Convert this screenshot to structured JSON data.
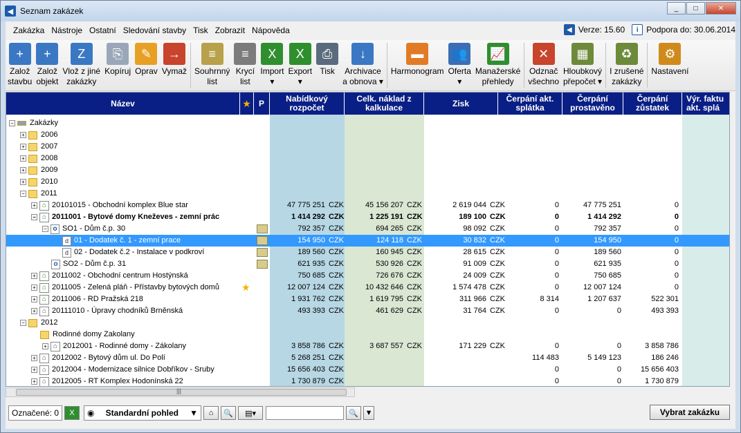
{
  "window": {
    "title": "Seznam zakázek",
    "min": "_",
    "max": "□",
    "close": "✕"
  },
  "menu": {
    "items": [
      "Zakázka",
      "Nástroje",
      "Ostatní",
      "Sledování stavby",
      "Tisk",
      "Zobrazit",
      "Nápověda"
    ]
  },
  "version": {
    "label": "Verze: 15.60",
    "support": "Podpora do: 30.06.2014"
  },
  "toolbar": {
    "buttons": [
      {
        "l1": "Založ",
        "l2": "stavbu",
        "icon": "new-project-icon"
      },
      {
        "l1": "Založ",
        "l2": "objekt",
        "icon": "new-object-icon"
      },
      {
        "l1": "Vlož z jiné",
        "l2": "zakázky",
        "icon": "insert-icon"
      },
      {
        "l1": "Kopíruj",
        "l2": "",
        "icon": "copy-icon"
      },
      {
        "l1": "Oprav",
        "l2": "",
        "icon": "edit-icon"
      },
      {
        "l1": "Vymaž",
        "l2": "",
        "icon": "delete-icon"
      },
      {
        "l1": "Souhrnný",
        "l2": "list",
        "icon": "summary-icon"
      },
      {
        "l1": "Krycí",
        "l2": "list",
        "icon": "cover-sheet-icon"
      },
      {
        "l1": "Import",
        "l2": "▾",
        "icon": "import-icon"
      },
      {
        "l1": "Export",
        "l2": "▾",
        "icon": "export-icon"
      },
      {
        "l1": "Tisk",
        "l2": "",
        "icon": "print-icon"
      },
      {
        "l1": "Archivace",
        "l2": "a obnova ▾",
        "icon": "archive-icon"
      },
      {
        "l1": "Harmonogram",
        "l2": "",
        "icon": "schedule-icon"
      },
      {
        "l1": "Oferta",
        "l2": "▾",
        "icon": "offer-icon"
      },
      {
        "l1": "Manažerské",
        "l2": "přehledy",
        "icon": "chart-icon"
      },
      {
        "l1": "Odznač",
        "l2": "všechno",
        "icon": "uncheck-icon"
      },
      {
        "l1": "Hloubkový",
        "l2": "přepočet ▾",
        "icon": "calculator-icon"
      },
      {
        "l1": "I zrušené",
        "l2": "zakázky",
        "icon": "recycle-icon"
      },
      {
        "l1": "Nastavení",
        "l2": "",
        "icon": "settings-icon"
      }
    ]
  },
  "grid": {
    "headers": {
      "name": "Název",
      "p": "P",
      "offer": [
        "Nabídkový",
        "rozpočet"
      ],
      "cost": [
        "Celk. náklad z",
        "kalkulace"
      ],
      "profit": "Zisk",
      "draw_inst": [
        "Čerpání akt.",
        "splátka"
      ],
      "draw_done": [
        "Čerpání",
        "prostavěno"
      ],
      "draw_rest": [
        "Čerpání",
        "zůstatek"
      ],
      "invoice": [
        "Výr. faktu",
        "akt. splá"
      ]
    },
    "rows": [
      {
        "label": "Zakázky",
        "indent": 0,
        "type": "root",
        "exp": "−"
      },
      {
        "label": "2006",
        "indent": 1,
        "type": "folder",
        "exp": "+"
      },
      {
        "label": "2007",
        "indent": 1,
        "type": "folder",
        "exp": "+"
      },
      {
        "label": "2008",
        "indent": 1,
        "type": "folder",
        "exp": "+"
      },
      {
        "label": "2009",
        "indent": 1,
        "type": "folder",
        "exp": "+"
      },
      {
        "label": "2010",
        "indent": 1,
        "type": "folder",
        "exp": "+"
      },
      {
        "label": "2011",
        "indent": 1,
        "type": "folder",
        "exp": "−"
      },
      {
        "label": "20101015 - Obchodní komplex Blue star",
        "indent": 2,
        "type": "house",
        "exp": "+",
        "offer": "47 775 251",
        "cost": "45 156 207",
        "profit": "2 619 044",
        "inst": "0",
        "done": "47 775 251",
        "rest": "0"
      },
      {
        "label": "2011001 - Bytové domy Kneževes - zemní prác",
        "indent": 2,
        "type": "house",
        "exp": "−",
        "bold": true,
        "offer": "1 414 292",
        "cost": "1 225 191",
        "profit": "189 100",
        "inst": "0",
        "done": "1 414 292",
        "rest": "0"
      },
      {
        "label": "SO1 - Dům č.p. 30",
        "indent": 3,
        "type": "obj",
        "exp": "−",
        "p": true,
        "offer": "792 357",
        "cost": "694 265",
        "profit": "98 092",
        "inst": "0",
        "done": "792 357",
        "rest": "0"
      },
      {
        "label": "01 - Dodatek č. 1 - zemní prace",
        "indent": 4,
        "type": "doc",
        "p": true,
        "sel": true,
        "offer": "154 950",
        "cost": "124 118",
        "profit": "30 832",
        "inst": "0",
        "done": "154 950",
        "rest": "0"
      },
      {
        "label": "02 - Dodatek č.2 - Instalace v podkroví",
        "indent": 4,
        "type": "doc",
        "p": true,
        "offer": "189 560",
        "cost": "160 945",
        "profit": "28 615",
        "inst": "0",
        "done": "189 560",
        "rest": "0"
      },
      {
        "label": "SO2 - Dům č.p. 31",
        "indent": 3,
        "type": "obj",
        "p": true,
        "offer": "621 935",
        "cost": "530 926",
        "profit": "91 009",
        "inst": "0",
        "done": "621 935",
        "rest": "0"
      },
      {
        "label": "2011002 - Obchodní centrum Hostýnská",
        "indent": 2,
        "type": "house",
        "exp": "+",
        "offer": "750 685",
        "cost": "726 676",
        "profit": "24 009",
        "inst": "0",
        "done": "750 685",
        "rest": "0"
      },
      {
        "label": "2011005 - Zelená pláň - Přístavby bytových domů",
        "indent": 2,
        "type": "house",
        "exp": "+",
        "star": true,
        "offer": "12 007 124",
        "cost": "10 432 646",
        "profit": "1 574 478",
        "inst": "0",
        "done": "12 007 124",
        "rest": "0"
      },
      {
        "label": "2011006 - RD Pražská 218",
        "indent": 2,
        "type": "house",
        "exp": "+",
        "offer": "1 931 762",
        "cost": "1 619 795",
        "profit": "311 966",
        "inst": "8 314",
        "done": "1 207 637",
        "rest": "522 301"
      },
      {
        "label": "20111010 - Úpravy chodníků Brněnská",
        "indent": 2,
        "type": "house2",
        "exp": "+",
        "offer": "493 393",
        "cost": "461 629",
        "profit": "31 764",
        "inst": "0",
        "done": "0",
        "rest": "493 393"
      },
      {
        "label": "2012",
        "indent": 1,
        "type": "folder",
        "exp": "−"
      },
      {
        "label": "Rodinné domy Zakolany",
        "indent": 2,
        "type": "folder"
      },
      {
        "label": "2012001 - Rodinné domy - Zákolany",
        "indent": 3,
        "type": "house2",
        "exp": "+",
        "offer": "3 858 786",
        "cost": "3 687 557",
        "profit": "171 229",
        "inst": "0",
        "done": "0",
        "rest": "3 858 786"
      },
      {
        "label": "2012002 - Bytový dům ul. Do Polí",
        "indent": 2,
        "type": "house2",
        "exp": "+",
        "offer": "5 268 251",
        "cost": "",
        "profit": "",
        "inst": "114 483",
        "done": "5 149 123",
        "rest": "186 246"
      },
      {
        "label": "2012004 - Modernizace silnice Dobříkov - Sruby",
        "indent": 2,
        "type": "house2",
        "exp": "+",
        "offer": "15 656 403",
        "cost": "",
        "profit": "",
        "inst": "0",
        "done": "0",
        "rest": "15 656 403"
      },
      {
        "label": "2012005 - RT Komplex Hodonínská 22",
        "indent": 2,
        "type": "house2",
        "exp": "+",
        "offer": "1 730 879",
        "cost": "",
        "profit": "",
        "inst": "0",
        "done": "0",
        "rest": "1 730 879"
      }
    ],
    "currency": "CZK"
  },
  "status": {
    "marked": "Označené: 0",
    "view": "Standardní pohled",
    "search_value": "",
    "choose": "Vybrat zakázku"
  },
  "scroll_glyph": "|||"
}
